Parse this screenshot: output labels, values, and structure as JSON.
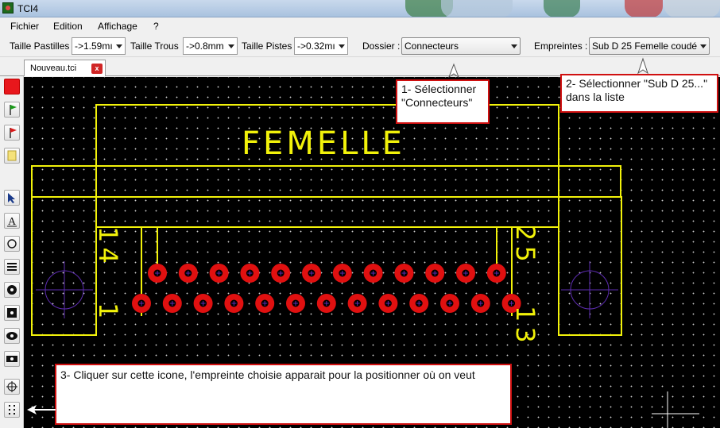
{
  "window": {
    "title": "TCI4",
    "icon": "app-icon"
  },
  "menu": [
    "Fichier",
    "Edition",
    "Affichage",
    "?"
  ],
  "toolbar": {
    "pastilles_label": "Taille Pastilles",
    "pastilles_value": "->1.59mı",
    "trous_label": "Taille Trous",
    "trous_value": "->0.8mm",
    "pistes_label": "Taille Pistes",
    "pistes_value": "->0.32mı",
    "dossier_label": "Dossier :",
    "dossier_value": "Connecteurs",
    "empreintes_label": "Empreintes :",
    "empreintes_value": "Sub D 25 Femelle coudé"
  },
  "tab": {
    "label": "Nouveau.tci",
    "close": "x"
  },
  "pcb": {
    "label_text": "FEMELLE",
    "pin_labels": [
      "14",
      "25",
      "1",
      "13"
    ],
    "pad_color": "#e01010",
    "silk_color": "#f2f20a"
  },
  "notes": {
    "step1": "1- Sélectionner \"Connecteurs\"",
    "step2": "2- Sélectionner \"Sub D 25...\" dans la liste",
    "step3": "3- Cliquer sur cette icone, l'empreinte choisie apparait pour la positionner où on veut"
  },
  "icons": {
    "tools": [
      "red-square-icon",
      "green-flag-icon",
      "red-flag-icon",
      "yellow-note-icon",
      "pointer-icon",
      "text-icon",
      "circle-pad-icon",
      "lines-icon",
      "round-pad-icon",
      "square-pad-icon",
      "oval-pad-icon",
      "rect-pad-icon",
      "crosshair-icon",
      "footprint-icon"
    ]
  },
  "colors": {
    "note_border": "#d01010",
    "canvas_bg": "#000000"
  }
}
